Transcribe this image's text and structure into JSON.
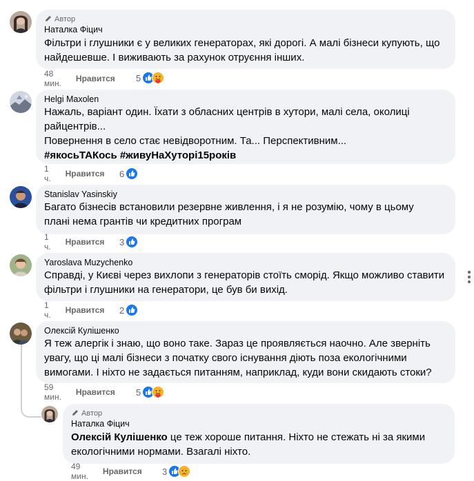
{
  "comments": [
    {
      "author_badge": "Автор",
      "name": "Наталка Фіцич",
      "lines": [
        "Фільтри і глушники є у великих генераторах, які дорогі. А малі бізнеси купують, що",
        "найдешевше. І виживають за рахунок отруєння інших."
      ],
      "time": "48 мин.",
      "like_label": "Нравится",
      "reaction_count": "5",
      "reactions": [
        "like-icon",
        "care-icon"
      ]
    },
    {
      "name": "Helgi Maxolen",
      "lines": [
        "Нажаль, варіант один. Їхати з обласних центрів в хутори, малі села, околиці",
        "райцентрів...",
        "Повернення в село стає невідворотним. Та... Перспективним..."
      ],
      "hashtags": "#якосьТАКось #живуНаХуторі15років",
      "time": "1 ч.",
      "like_label": "Нравится",
      "reaction_count": "6",
      "reactions": [
        "like-icon"
      ]
    },
    {
      "name": "Stanislav Yasinskiy",
      "lines": [
        "Багато бізнесів встановили резервне живлення, і я не розумію, чому в цьому",
        "плані нема грантів чи кредитних програм"
      ],
      "time": "1 ч.",
      "like_label": "Нравится",
      "reaction_count": "3",
      "reactions": [
        "like-icon"
      ]
    },
    {
      "name": "Yaroslava Muzychenko",
      "lines": [
        "Справді, у Києві через вихлопи з генераторів стоїть сморід. Якщо можливо ставити",
        "фільтри і глушники на генератори, це був би вихід."
      ],
      "time": "1 ч.",
      "like_label": "Нравится",
      "reaction_count": "2",
      "reactions": [
        "like-icon"
      ]
    },
    {
      "name": "Олексій Кулішенко",
      "lines": [
        "Я теж алергік і знаю, що воно таке. Зараз це проявляється наочно. Але зверніть",
        "увагу, що ці малі бізнеси з початку свого існування діють поза екологічними",
        "вимогами. І ніхто не задається питанням, наприклад, куди вони скидають стоки?"
      ],
      "time": "59 мин.",
      "like_label": "Нравится",
      "reaction_count": "5",
      "reactions": [
        "like-icon",
        "care-icon"
      ]
    }
  ],
  "reply": {
    "author_badge": "Автор",
    "name": "Наталка Фіцич",
    "mention": "Олексій Кулішенко",
    "line1_rest": " це теж хороше питання. Ніхто не стежать ні за якими",
    "line2": "екологічними нормами. Взагалі ніхто.",
    "time": "49 мин.",
    "like_label": "Нравится",
    "reaction_count": "3",
    "reactions": [
      "like-icon",
      "sad-icon"
    ]
  },
  "colors": {
    "bubble": "#f0f2f5",
    "like_blue": "#1877f2",
    "meta_gray": "#65676b"
  }
}
